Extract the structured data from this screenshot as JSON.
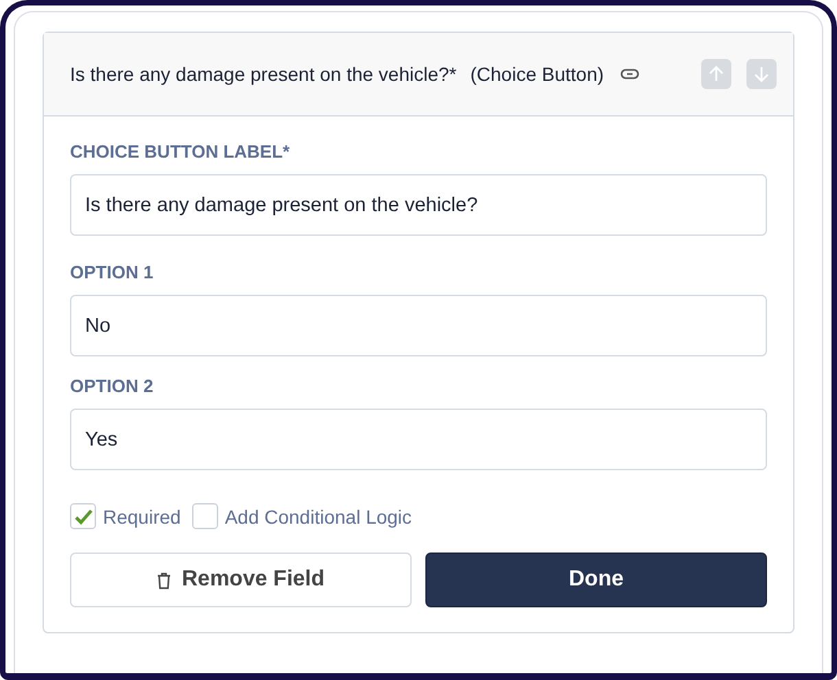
{
  "header": {
    "title": "Is there any damage present on the vehicle?*",
    "type": "(Choice Button)",
    "move_up_disabled": true,
    "move_down_disabled": true
  },
  "fields": [
    {
      "label": "CHOICE BUTTON LABEL*",
      "value": "Is there any damage present on the vehicle?"
    },
    {
      "label": "OPTION 1",
      "value": "No"
    },
    {
      "label": "OPTION 2",
      "value": "Yes"
    }
  ],
  "checkboxes": [
    {
      "label": "Required",
      "checked": true
    },
    {
      "label": "Add Conditional Logic",
      "checked": false
    }
  ],
  "buttons": {
    "remove": "Remove Field",
    "done": "Done"
  }
}
